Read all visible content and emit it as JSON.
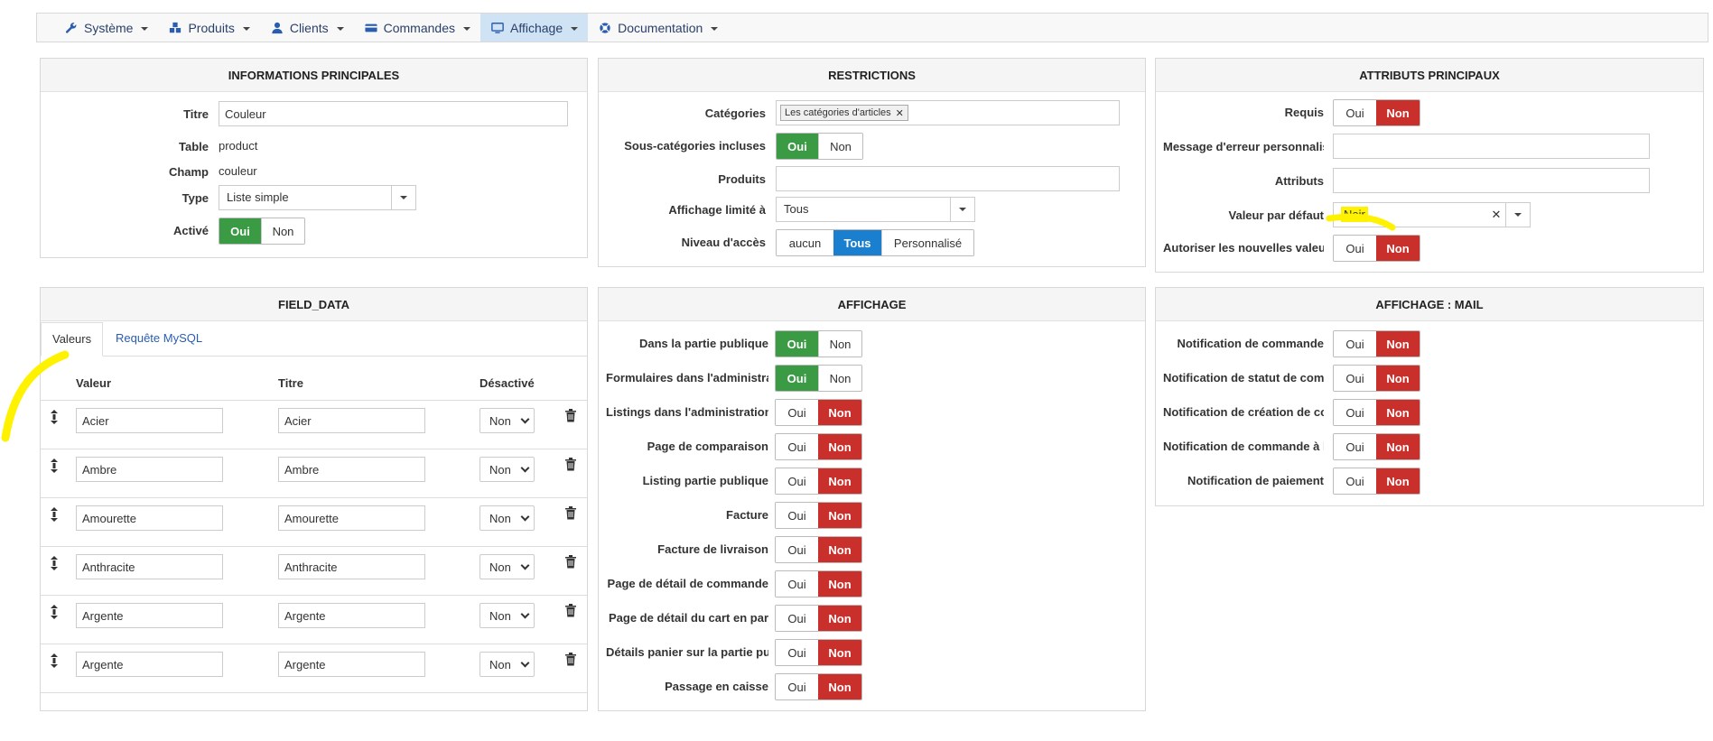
{
  "nav": [
    {
      "label": "Système",
      "icon": "wrench-icon"
    },
    {
      "label": "Produits",
      "icon": "cubes-icon"
    },
    {
      "label": "Clients",
      "icon": "user-icon"
    },
    {
      "label": "Commandes",
      "icon": "credit-card-icon"
    },
    {
      "label": "Affichage",
      "icon": "monitor-icon",
      "active": true
    },
    {
      "label": "Documentation",
      "icon": "life-ring-icon"
    }
  ],
  "info": {
    "title": "INFORMATIONS PRINCIPALES",
    "titre_label": "Titre",
    "titre_value": "Couleur",
    "table_label": "Table",
    "table_value": "product",
    "champ_label": "Champ",
    "champ_value": "couleur",
    "type_label": "Type",
    "type_value": "Liste simple",
    "active_label": "Activé",
    "oui": "Oui",
    "non": "Non"
  },
  "restrictions": {
    "title": "RESTRICTIONS",
    "categories_label": "Catégories",
    "categories_tag": "Les catégories d'articles",
    "subcat_label": "Sous-catégories incluses",
    "produits_label": "Produits",
    "affichage_label": "Affichage limité à",
    "affichage_value": "Tous",
    "niveau_label": "Niveau d'accès",
    "niveau_opts": [
      "aucun",
      "Tous",
      "Personnalisé"
    ],
    "oui": "Oui",
    "non": "Non"
  },
  "attributs": {
    "title": "ATTRIBUTS PRINCIPAUX",
    "requis_label": "Requis",
    "message_label": "Message d'erreur personnalis",
    "attributs_label": "Attributs",
    "defaut_label": "Valeur par défaut",
    "defaut_value": "Noir",
    "autoriser_label": "Autoriser les nouvelles valeur",
    "oui": "Oui",
    "non": "Non"
  },
  "field_data": {
    "title": "FIELD_DATA",
    "tab_valeurs": "Valeurs",
    "tab_mysql": "Requête MySQL",
    "col_valeur": "Valeur",
    "col_titre": "Titre",
    "col_desactive": "Désactivé",
    "rows": [
      {
        "valeur": "Acier",
        "titre": "Acier",
        "desactive": "Non"
      },
      {
        "valeur": "Ambre",
        "titre": "Ambre",
        "desactive": "Non"
      },
      {
        "valeur": "Amourette",
        "titre": "Amourette",
        "desactive": "Non"
      },
      {
        "valeur": "Anthracite",
        "titre": "Anthracite",
        "desactive": "Non"
      },
      {
        "valeur": "Argente",
        "titre": "Argente",
        "desactive": "Non"
      },
      {
        "valeur": "Argente",
        "titre": "Argente",
        "desactive": "Non"
      }
    ]
  },
  "affichage": {
    "title": "AFFICHAGE",
    "oui": "Oui",
    "non": "Non",
    "rows": [
      {
        "label": "Dans la partie publique",
        "state": "oui"
      },
      {
        "label": "Formulaires dans l'administra",
        "state": "oui"
      },
      {
        "label": "Listings dans l'administration",
        "state": "non"
      },
      {
        "label": "Page de comparaison",
        "state": "non"
      },
      {
        "label": "Listing partie publique",
        "state": "non"
      },
      {
        "label": "Facture",
        "state": "non"
      },
      {
        "label": "Facture de livraison",
        "state": "non"
      },
      {
        "label": "Page de détail de commande",
        "state": "non"
      },
      {
        "label": "Page de détail du cart en par",
        "state": "non"
      },
      {
        "label": "Détails panier sur la partie pu",
        "state": "non"
      },
      {
        "label": "Passage en caisse",
        "state": "non"
      }
    ]
  },
  "mail": {
    "title": "AFFICHAGE : MAIL",
    "oui": "Oui",
    "non": "Non",
    "rows": [
      {
        "label": "Notification de commande",
        "state": "non"
      },
      {
        "label": "Notification de statut de com",
        "state": "non"
      },
      {
        "label": "Notification de création de co",
        "state": "non"
      },
      {
        "label": "Notification de commande à l",
        "state": "non"
      },
      {
        "label": "Notification de paiement",
        "state": "non"
      }
    ]
  },
  "colors": {
    "green": "#3b9b45",
    "red": "#c9302c",
    "blue": "#1a7fcf",
    "highlight": "#fff200"
  }
}
